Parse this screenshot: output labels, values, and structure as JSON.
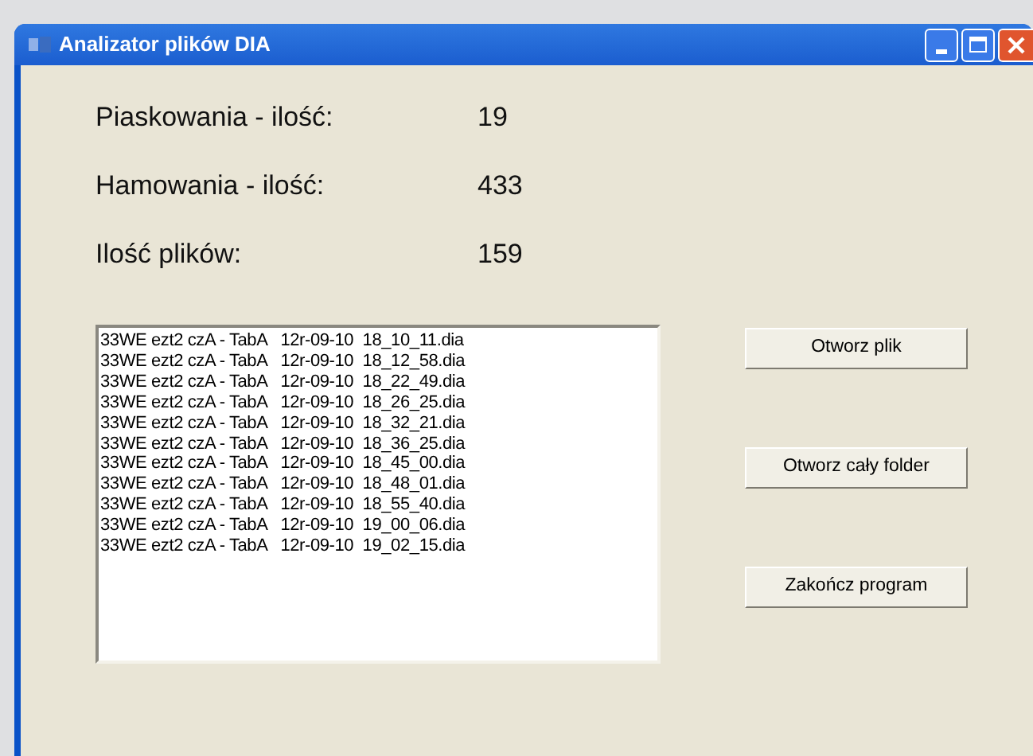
{
  "window": {
    "title": "Analizator plików DIA"
  },
  "stats": [
    {
      "label": "Piaskowania - ilość:",
      "value": "19"
    },
    {
      "label": "Hamowania - ilość:",
      "value": "433"
    },
    {
      "label": "Ilość plików:",
      "value": "159"
    }
  ],
  "file_list": [
    "33WE ezt2 czA - TabA   12r-09-10  18_10_11.dia",
    "33WE ezt2 czA - TabA   12r-09-10  18_12_58.dia",
    "33WE ezt2 czA - TabA   12r-09-10  18_22_49.dia",
    "33WE ezt2 czA - TabA   12r-09-10  18_26_25.dia",
    "33WE ezt2 czA - TabA   12r-09-10  18_32_21.dia",
    "33WE ezt2 czA - TabA   12r-09-10  18_36_25.dia",
    "33WE ezt2 czA - TabA   12r-09-10  18_45_00.dia",
    "33WE ezt2 czA - TabA   12r-09-10  18_48_01.dia",
    "33WE ezt2 czA - TabA   12r-09-10  18_55_40.dia",
    "33WE ezt2 czA - TabA   12r-09-10  19_00_06.dia",
    "33WE ezt2 czA - TabA   12r-09-10  19_02_15.dia"
  ],
  "buttons": [
    "Otworz plik",
    "Otworz cały folder",
    "Zakończ program"
  ]
}
